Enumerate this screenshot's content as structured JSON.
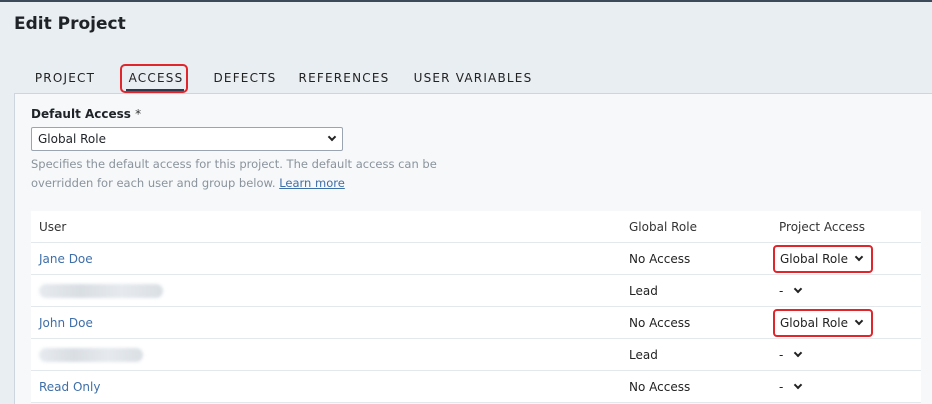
{
  "page": {
    "title": "Edit Project"
  },
  "tabs": [
    {
      "label": "PROJECT"
    },
    {
      "label": "ACCESS"
    },
    {
      "label": "DEFECTS"
    },
    {
      "label": "REFERENCES"
    },
    {
      "label": "USER VARIABLES"
    }
  ],
  "active_tab": "ACCESS",
  "default_access": {
    "label": "Default Access",
    "required_mark": "*",
    "value": "Global Role",
    "help_text": "Specifies the default access for this project. The default access can be overridden for each user and group below.",
    "learn_more": "Learn more"
  },
  "table": {
    "headers": {
      "user": "User",
      "global_role": "Global Role",
      "project_access": "Project Access"
    },
    "rows": [
      {
        "user": "Jane Doe",
        "global_role": "No Access",
        "project_access": "Global Role"
      },
      {
        "user": "",
        "global_role": "Lead",
        "project_access": "-"
      },
      {
        "user": "John Doe",
        "global_role": "No Access",
        "project_access": "Global Role"
      },
      {
        "user": "",
        "global_role": "Lead",
        "project_access": "-"
      },
      {
        "user": "Read Only",
        "global_role": "No Access",
        "project_access": "-"
      }
    ]
  },
  "colors": {
    "accent_link": "#3f6fa8",
    "highlight": "#e0252b",
    "tab_underline": "#2b3a4f"
  }
}
